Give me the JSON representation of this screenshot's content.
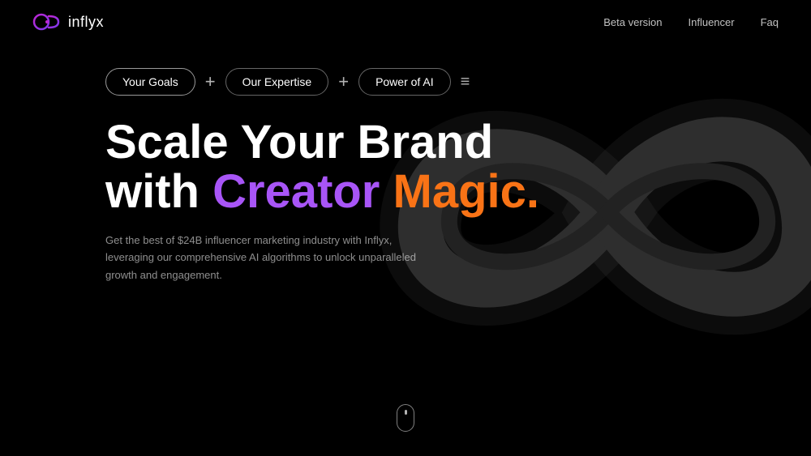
{
  "brand": {
    "name": "inflyx",
    "logo_alt": "inflyx logo"
  },
  "nav": {
    "links": [
      {
        "label": "Beta version"
      },
      {
        "label": "Influencer"
      },
      {
        "label": "Faq"
      }
    ]
  },
  "hero": {
    "tags": [
      {
        "id": "goals",
        "label": "Your Goals"
      },
      {
        "id": "expertise",
        "label": "Our Expertise"
      },
      {
        "id": "ai",
        "label": "Power of AI"
      }
    ],
    "headline_line1": "Scale Your Brand",
    "headline_line2_prefix": "with ",
    "headline_creator": "Creator",
    "headline_space": " ",
    "headline_magic": "Magic.",
    "subtext": "Get the best of $24B influencer marketing industry with Inflyx, leveraging our comprehensive AI algorithms to unlock unparalleled growth and engagement.",
    "colors": {
      "creator": "#a855f7",
      "magic": "#f97316"
    }
  }
}
